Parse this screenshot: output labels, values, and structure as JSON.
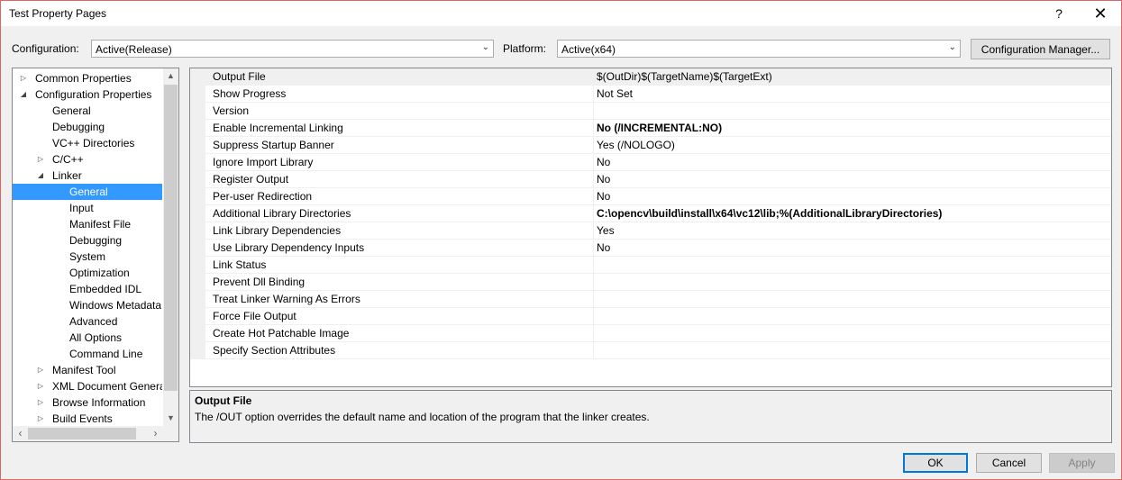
{
  "window": {
    "title": "Test Property Pages",
    "help": "?",
    "close": "✕"
  },
  "config": {
    "config_label": "Configuration:",
    "config_value": "Active(Release)",
    "platform_label": "Platform:",
    "platform_value": "Active(x64)",
    "manager_button": "Configuration Manager..."
  },
  "tree": [
    {
      "label": "Common Properties",
      "expander": "▷",
      "level": 0
    },
    {
      "label": "Configuration Properties",
      "expander": "◢",
      "level": 0
    },
    {
      "label": "General",
      "expander": "",
      "level": 1
    },
    {
      "label": "Debugging",
      "expander": "",
      "level": 1
    },
    {
      "label": "VC++ Directories",
      "expander": "",
      "level": 1
    },
    {
      "label": "C/C++",
      "expander": "▷",
      "level": 1
    },
    {
      "label": "Linker",
      "expander": "◢",
      "level": 1
    },
    {
      "label": "General",
      "expander": "",
      "level": 2,
      "selected": true
    },
    {
      "label": "Input",
      "expander": "",
      "level": 2
    },
    {
      "label": "Manifest File",
      "expander": "",
      "level": 2
    },
    {
      "label": "Debugging",
      "expander": "",
      "level": 2
    },
    {
      "label": "System",
      "expander": "",
      "level": 2
    },
    {
      "label": "Optimization",
      "expander": "",
      "level": 2
    },
    {
      "label": "Embedded IDL",
      "expander": "",
      "level": 2
    },
    {
      "label": "Windows Metadata",
      "expander": "",
      "level": 2
    },
    {
      "label": "Advanced",
      "expander": "",
      "level": 2
    },
    {
      "label": "All Options",
      "expander": "",
      "level": 2
    },
    {
      "label": "Command Line",
      "expander": "",
      "level": 2
    },
    {
      "label": "Manifest Tool",
      "expander": "▷",
      "level": 1
    },
    {
      "label": "XML Document Genera",
      "expander": "▷",
      "level": 1
    },
    {
      "label": "Browse Information",
      "expander": "▷",
      "level": 1
    },
    {
      "label": "Build Events",
      "expander": "▷",
      "level": 1
    }
  ],
  "scroll": {
    "up": "▲",
    "down": "▼",
    "left": "‹",
    "right": "›"
  },
  "properties": [
    {
      "name": "Output File",
      "value": "$(OutDir)$(TargetName)$(TargetExt)",
      "bold": false
    },
    {
      "name": "Show Progress",
      "value": "Not Set",
      "bold": false
    },
    {
      "name": "Version",
      "value": "",
      "bold": false
    },
    {
      "name": "Enable Incremental Linking",
      "value": "No (/INCREMENTAL:NO)",
      "bold": true
    },
    {
      "name": "Suppress Startup Banner",
      "value": "Yes (/NOLOGO)",
      "bold": false
    },
    {
      "name": "Ignore Import Library",
      "value": "No",
      "bold": false
    },
    {
      "name": "Register Output",
      "value": "No",
      "bold": false
    },
    {
      "name": "Per-user Redirection",
      "value": "No",
      "bold": false
    },
    {
      "name": "Additional Library Directories",
      "value": "C:\\opencv\\build\\install\\x64\\vc12\\lib;%(AdditionalLibraryDirectories)",
      "bold": true
    },
    {
      "name": "Link Library Dependencies",
      "value": "Yes",
      "bold": false
    },
    {
      "name": "Use Library Dependency Inputs",
      "value": "No",
      "bold": false
    },
    {
      "name": "Link Status",
      "value": "",
      "bold": false
    },
    {
      "name": "Prevent Dll Binding",
      "value": "",
      "bold": false
    },
    {
      "name": "Treat Linker Warning As Errors",
      "value": "",
      "bold": false
    },
    {
      "name": "Force File Output",
      "value": "",
      "bold": false
    },
    {
      "name": "Create Hot Patchable Image",
      "value": "",
      "bold": false
    },
    {
      "name": "Specify Section Attributes",
      "value": "",
      "bold": false
    }
  ],
  "description": {
    "title": "Output File",
    "text": "The /OUT option overrides the default name and location of the program that the linker creates."
  },
  "buttons": {
    "ok": "OK",
    "cancel": "Cancel",
    "apply": "Apply"
  }
}
